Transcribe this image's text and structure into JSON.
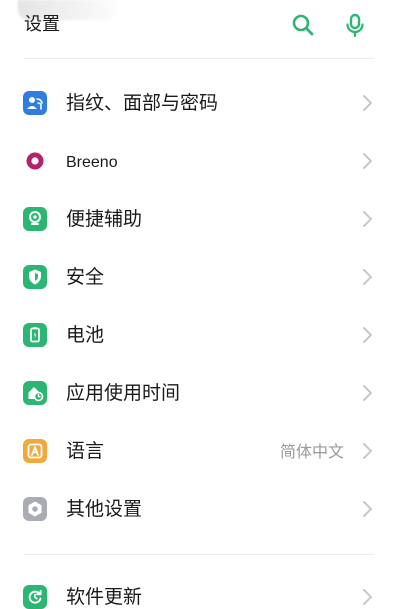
{
  "header": {
    "title": "设置"
  },
  "colors": {
    "accent": "#2bb673",
    "blue": "#2f7de1",
    "breeno": "#b3226b",
    "orange": "#f2a93b",
    "gray_icon": "#a9adb3",
    "chevron": "#c7c7c7"
  },
  "settings": {
    "items": [
      {
        "label": "指纹、面部与密码",
        "icon": "fingerprint-face-password-icon"
      },
      {
        "label": "Breeno",
        "icon": "breeno-icon"
      },
      {
        "label": "便捷辅助",
        "icon": "convenience-assist-icon"
      },
      {
        "label": "安全",
        "icon": "security-shield-icon"
      },
      {
        "label": "电池",
        "icon": "battery-icon"
      },
      {
        "label": "应用使用时间",
        "icon": "app-usage-time-icon"
      },
      {
        "label": "语言",
        "icon": "language-icon",
        "value": "简体中文"
      },
      {
        "label": "其他设置",
        "icon": "other-settings-icon"
      },
      {
        "label": "软件更新",
        "icon": "software-update-icon"
      }
    ]
  }
}
